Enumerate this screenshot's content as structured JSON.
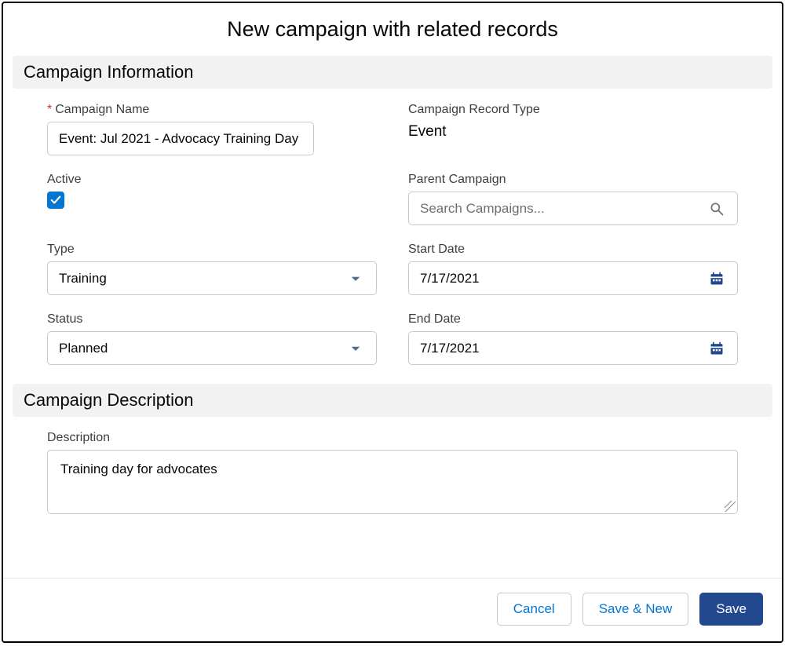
{
  "modal": {
    "title": "New campaign with related records"
  },
  "sections": {
    "info": {
      "heading": "Campaign Information"
    },
    "desc": {
      "heading": "Campaign Description"
    }
  },
  "fields": {
    "campaignName": {
      "label": "Campaign Name",
      "value": "Event: Jul 2021 - Advocacy Training Day",
      "required": true
    },
    "recordType": {
      "label": "Campaign Record Type",
      "value": "Event"
    },
    "active": {
      "label": "Active",
      "checked": true
    },
    "parent": {
      "label": "Parent Campaign",
      "placeholder": "Search Campaigns..."
    },
    "type": {
      "label": "Type",
      "value": "Training"
    },
    "startDate": {
      "label": "Start Date",
      "value": "7/17/2021"
    },
    "status": {
      "label": "Status",
      "value": "Planned"
    },
    "endDate": {
      "label": "End Date",
      "value": "7/17/2021"
    },
    "description": {
      "label": "Description",
      "value": "Training day for advocates"
    }
  },
  "footer": {
    "cancel": "Cancel",
    "saveNew": "Save & New",
    "save": "Save"
  },
  "colors": {
    "brand": "#0176d3",
    "primaryBtn": "#22498f"
  }
}
